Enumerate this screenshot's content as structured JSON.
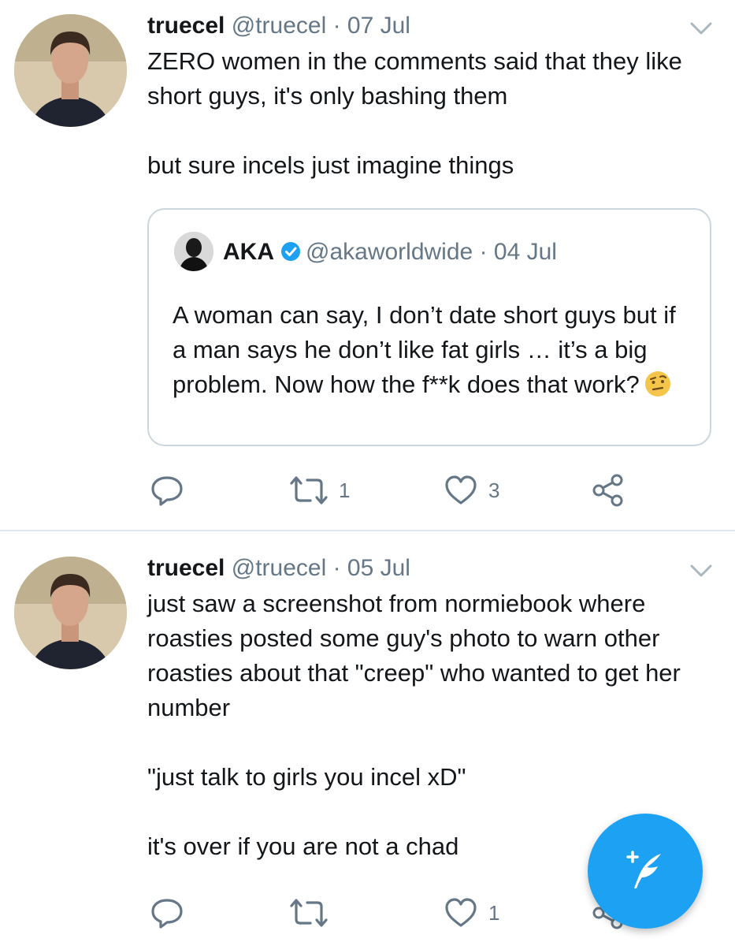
{
  "tweets": [
    {
      "name": "truecel",
      "handle": "@truecel",
      "date": "07 Jul",
      "text": "ZERO women in the comments said that they like short guys, it's only bashing them\n\nbut sure incels just imagine things",
      "quote": {
        "name": "AKA",
        "handle": "@akaworldwide",
        "date": "04 Jul",
        "text": "A woman can say, I don’t date short guys but if a man says he don’t like fat girls … it’s a big problem. Now how the f**k does that work?"
      },
      "retweets": "1",
      "likes": "3"
    },
    {
      "name": "truecel",
      "handle": "@truecel",
      "date": "05 Jul",
      "text": "just saw a screenshot from normiebook where roasties posted some guy's photo to warn other roasties about that \"creep\" who wanted to get her number\n\n\"just talk to girls you incel xD\"\n\nit's over if you are not a chad",
      "retweets": "",
      "likes": "1"
    }
  ],
  "separator": "·",
  "icons": {
    "reply": "reply-icon",
    "retweet": "retweet-icon",
    "like": "heart-icon",
    "share": "share-icon",
    "caret": "chevron-down-icon",
    "verified": "verified-badge-icon",
    "compose": "compose-tweet-icon"
  },
  "colors": {
    "accent": "#1da1f2",
    "text": "#14171a",
    "secondary": "#657786",
    "border": "#ccd6dd"
  }
}
